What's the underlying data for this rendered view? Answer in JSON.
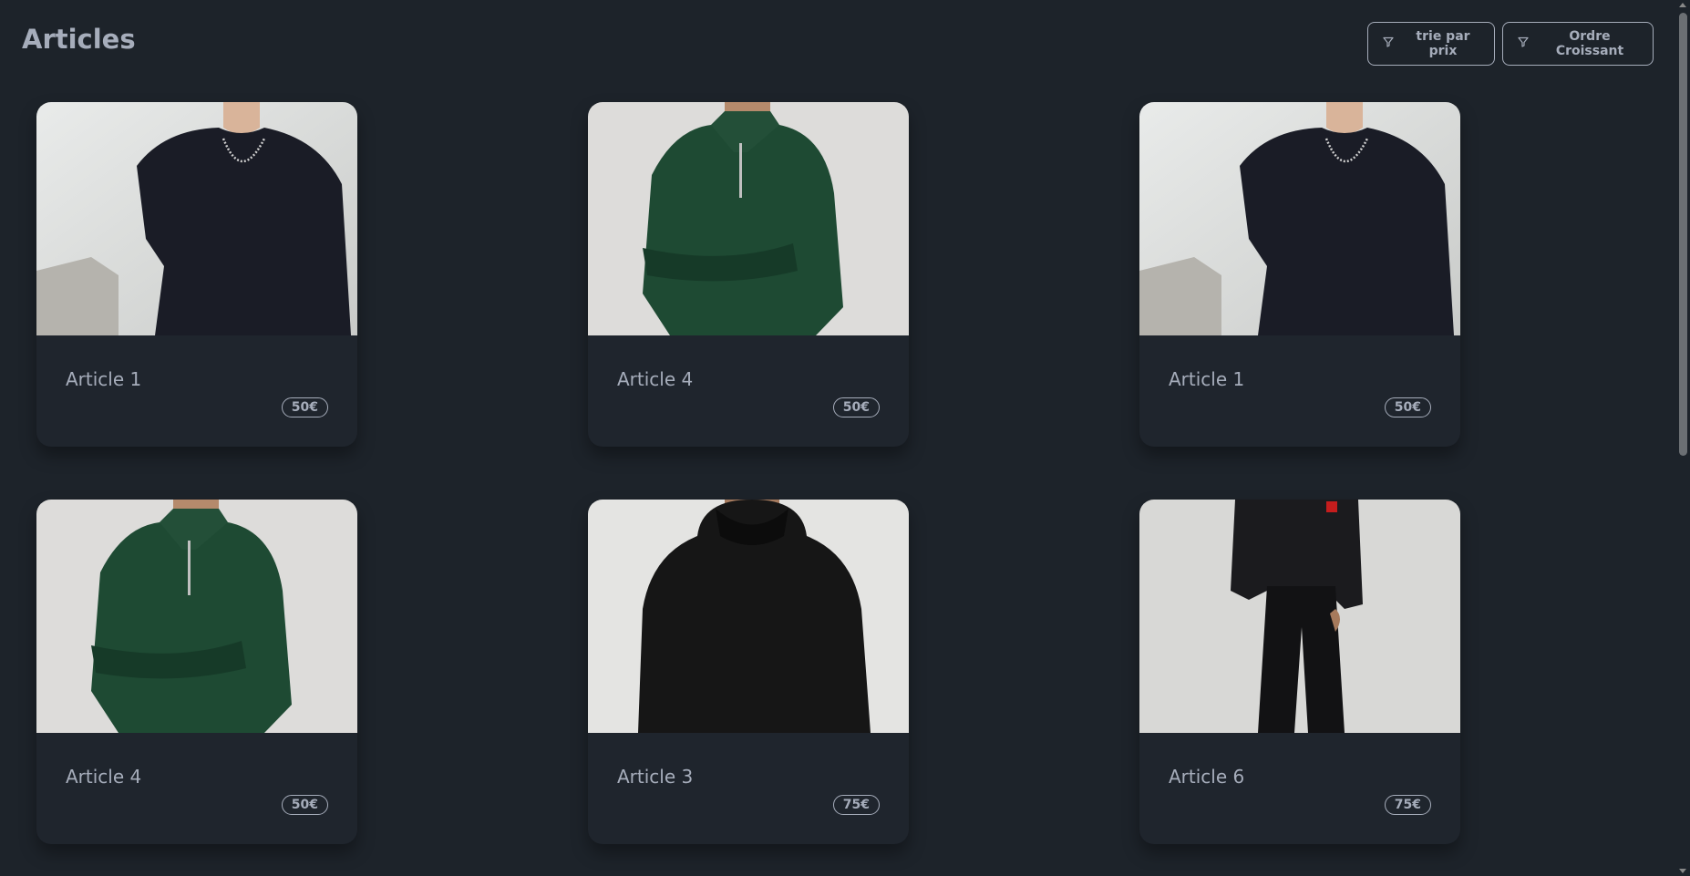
{
  "header": {
    "title": "Articles",
    "sort_price_label": "trie par prix",
    "order_label": "Ordre Croissant",
    "filter_icon": "filter-icon"
  },
  "articles": [
    {
      "title": "Article 1",
      "price": "50€",
      "image": "navy-crewneck-sweater-chain"
    },
    {
      "title": "Article 4",
      "price": "50€",
      "image": "green-half-zip-sweater"
    },
    {
      "title": "Article 1",
      "price": "50€",
      "image": "navy-crewneck-sweater-chain"
    },
    {
      "title": "Article 4",
      "price": "50€",
      "image": "green-half-zip-sweater"
    },
    {
      "title": "Article 3",
      "price": "75€",
      "image": "black-hoodie"
    },
    {
      "title": "Article 6",
      "price": "75€",
      "image": "black-jacket-pants"
    }
  ],
  "colors": {
    "background": "#1d232a",
    "text": "#a6adbb",
    "card": "#1f252d"
  }
}
